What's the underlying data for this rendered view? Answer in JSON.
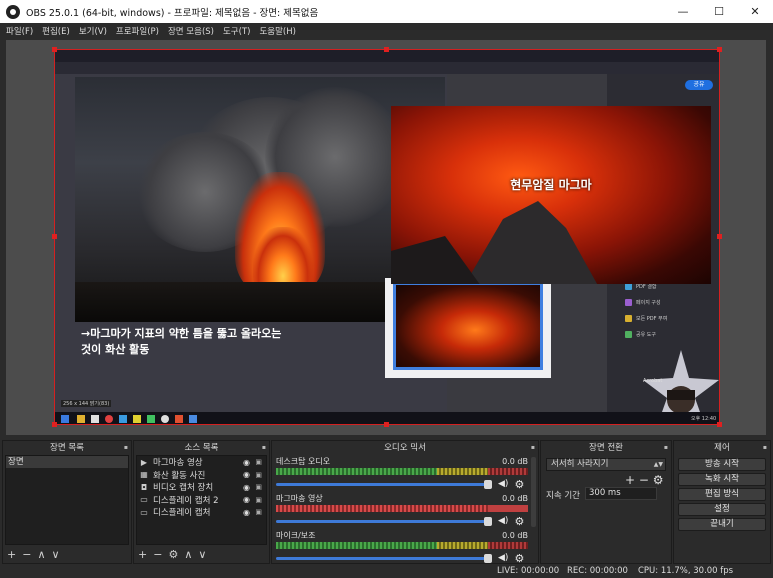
{
  "window": {
    "title": "OBS 25.0.1 (64-bit, windows) - 프로파일: 제목없음 - 장면: 제목없음",
    "minimize": "—",
    "maximize": "☐",
    "close": "✕"
  },
  "menu": [
    "파일(F)",
    "편집(E)",
    "보기(V)",
    "프로파일(P)",
    "장면 모음(S)",
    "도구(T)",
    "도움말(H)"
  ],
  "preview": {
    "caption_line1": "→마그마가 지표의 약한 틈을 뚫고 올라오는",
    "caption_line2": "것이 화산 활동",
    "magma_title": "현무암질 마그마",
    "share_label": "공유",
    "side_items": [
      "PDF 결합",
      "페이지 구성",
      "모든 PDF 부여",
      "공유 도구"
    ],
    "acrobat_label": "Acrobat",
    "zoom_label": "256 x 144 밝기(83)",
    "clock": "오후 12:40"
  },
  "scenes": {
    "title": "장면 목록",
    "items": [
      "장면"
    ],
    "footer": [
      "+",
      "−",
      "∧",
      "∨"
    ]
  },
  "sources": {
    "title": "소스 목록",
    "items": [
      {
        "icon": "▶",
        "name": "마그마송 영상"
      },
      {
        "icon": "▦",
        "name": "화산 활동 사진"
      },
      {
        "icon": "◘",
        "name": "비디오 캡처 장치"
      },
      {
        "icon": "▭",
        "name": "디스플레이 캡처 2"
      },
      {
        "icon": "▭",
        "name": "디스플레이 캡처"
      }
    ],
    "footer": [
      "+",
      "−",
      "⚙",
      "∧",
      "∨"
    ]
  },
  "mixer": {
    "title": "오디오 믹서",
    "channels": [
      {
        "name": "데스크탑 오디오",
        "db": "0.0 dB"
      },
      {
        "name": "마그마송 영상",
        "db": "0.0 dB"
      },
      {
        "name": "마이크/보조",
        "db": "0.0 dB"
      }
    ]
  },
  "transitions": {
    "title": "장면 전환",
    "selected": "서서히 사라지기",
    "plus": "+",
    "minus": "−",
    "duration_label": "지속 기간",
    "duration_value": "300 ms"
  },
  "controls": {
    "title": "제어",
    "buttons": [
      "방송 시작",
      "녹화 시작",
      "편집 방식",
      "설정",
      "끝내기"
    ]
  },
  "status": {
    "live": "LIVE: 00:00:00",
    "rec": "REC: 00:00:00",
    "cpu": "CPU: 11.7%, 30.00 fps"
  }
}
